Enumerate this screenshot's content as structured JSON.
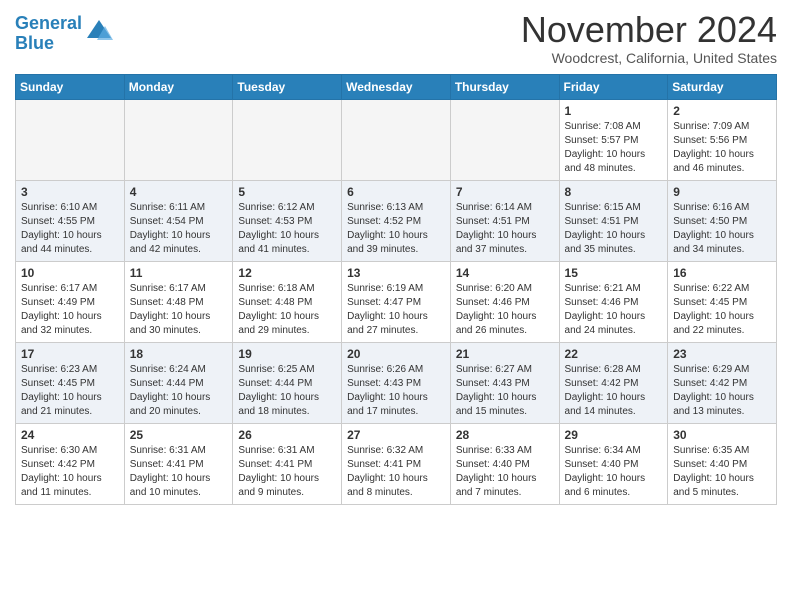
{
  "header": {
    "logo_line1": "General",
    "logo_line2": "Blue",
    "month_title": "November 2024",
    "location": "Woodcrest, California, United States"
  },
  "days_of_week": [
    "Sunday",
    "Monday",
    "Tuesday",
    "Wednesday",
    "Thursday",
    "Friday",
    "Saturday"
  ],
  "weeks": [
    [
      {
        "day": "",
        "info": "",
        "empty": true
      },
      {
        "day": "",
        "info": "",
        "empty": true
      },
      {
        "day": "",
        "info": "",
        "empty": true
      },
      {
        "day": "",
        "info": "",
        "empty": true
      },
      {
        "day": "",
        "info": "",
        "empty": true
      },
      {
        "day": "1",
        "info": "Sunrise: 7:08 AM\nSunset: 5:57 PM\nDaylight: 10 hours\nand 48 minutes.",
        "empty": false
      },
      {
        "day": "2",
        "info": "Sunrise: 7:09 AM\nSunset: 5:56 PM\nDaylight: 10 hours\nand 46 minutes.",
        "empty": false
      }
    ],
    [
      {
        "day": "3",
        "info": "Sunrise: 6:10 AM\nSunset: 4:55 PM\nDaylight: 10 hours\nand 44 minutes.",
        "empty": false
      },
      {
        "day": "4",
        "info": "Sunrise: 6:11 AM\nSunset: 4:54 PM\nDaylight: 10 hours\nand 42 minutes.",
        "empty": false
      },
      {
        "day": "5",
        "info": "Sunrise: 6:12 AM\nSunset: 4:53 PM\nDaylight: 10 hours\nand 41 minutes.",
        "empty": false
      },
      {
        "day": "6",
        "info": "Sunrise: 6:13 AM\nSunset: 4:52 PM\nDaylight: 10 hours\nand 39 minutes.",
        "empty": false
      },
      {
        "day": "7",
        "info": "Sunrise: 6:14 AM\nSunset: 4:51 PM\nDaylight: 10 hours\nand 37 minutes.",
        "empty": false
      },
      {
        "day": "8",
        "info": "Sunrise: 6:15 AM\nSunset: 4:51 PM\nDaylight: 10 hours\nand 35 minutes.",
        "empty": false
      },
      {
        "day": "9",
        "info": "Sunrise: 6:16 AM\nSunset: 4:50 PM\nDaylight: 10 hours\nand 34 minutes.",
        "empty": false
      }
    ],
    [
      {
        "day": "10",
        "info": "Sunrise: 6:17 AM\nSunset: 4:49 PM\nDaylight: 10 hours\nand 32 minutes.",
        "empty": false
      },
      {
        "day": "11",
        "info": "Sunrise: 6:17 AM\nSunset: 4:48 PM\nDaylight: 10 hours\nand 30 minutes.",
        "empty": false
      },
      {
        "day": "12",
        "info": "Sunrise: 6:18 AM\nSunset: 4:48 PM\nDaylight: 10 hours\nand 29 minutes.",
        "empty": false
      },
      {
        "day": "13",
        "info": "Sunrise: 6:19 AM\nSunset: 4:47 PM\nDaylight: 10 hours\nand 27 minutes.",
        "empty": false
      },
      {
        "day": "14",
        "info": "Sunrise: 6:20 AM\nSunset: 4:46 PM\nDaylight: 10 hours\nand 26 minutes.",
        "empty": false
      },
      {
        "day": "15",
        "info": "Sunrise: 6:21 AM\nSunset: 4:46 PM\nDaylight: 10 hours\nand 24 minutes.",
        "empty": false
      },
      {
        "day": "16",
        "info": "Sunrise: 6:22 AM\nSunset: 4:45 PM\nDaylight: 10 hours\nand 22 minutes.",
        "empty": false
      }
    ],
    [
      {
        "day": "17",
        "info": "Sunrise: 6:23 AM\nSunset: 4:45 PM\nDaylight: 10 hours\nand 21 minutes.",
        "empty": false
      },
      {
        "day": "18",
        "info": "Sunrise: 6:24 AM\nSunset: 4:44 PM\nDaylight: 10 hours\nand 20 minutes.",
        "empty": false
      },
      {
        "day": "19",
        "info": "Sunrise: 6:25 AM\nSunset: 4:44 PM\nDaylight: 10 hours\nand 18 minutes.",
        "empty": false
      },
      {
        "day": "20",
        "info": "Sunrise: 6:26 AM\nSunset: 4:43 PM\nDaylight: 10 hours\nand 17 minutes.",
        "empty": false
      },
      {
        "day": "21",
        "info": "Sunrise: 6:27 AM\nSunset: 4:43 PM\nDaylight: 10 hours\nand 15 minutes.",
        "empty": false
      },
      {
        "day": "22",
        "info": "Sunrise: 6:28 AM\nSunset: 4:42 PM\nDaylight: 10 hours\nand 14 minutes.",
        "empty": false
      },
      {
        "day": "23",
        "info": "Sunrise: 6:29 AM\nSunset: 4:42 PM\nDaylight: 10 hours\nand 13 minutes.",
        "empty": false
      }
    ],
    [
      {
        "day": "24",
        "info": "Sunrise: 6:30 AM\nSunset: 4:42 PM\nDaylight: 10 hours\nand 11 minutes.",
        "empty": false
      },
      {
        "day": "25",
        "info": "Sunrise: 6:31 AM\nSunset: 4:41 PM\nDaylight: 10 hours\nand 10 minutes.",
        "empty": false
      },
      {
        "day": "26",
        "info": "Sunrise: 6:31 AM\nSunset: 4:41 PM\nDaylight: 10 hours\nand 9 minutes.",
        "empty": false
      },
      {
        "day": "27",
        "info": "Sunrise: 6:32 AM\nSunset: 4:41 PM\nDaylight: 10 hours\nand 8 minutes.",
        "empty": false
      },
      {
        "day": "28",
        "info": "Sunrise: 6:33 AM\nSunset: 4:40 PM\nDaylight: 10 hours\nand 7 minutes.",
        "empty": false
      },
      {
        "day": "29",
        "info": "Sunrise: 6:34 AM\nSunset: 4:40 PM\nDaylight: 10 hours\nand 6 minutes.",
        "empty": false
      },
      {
        "day": "30",
        "info": "Sunrise: 6:35 AM\nSunset: 4:40 PM\nDaylight: 10 hours\nand 5 minutes.",
        "empty": false
      }
    ]
  ]
}
